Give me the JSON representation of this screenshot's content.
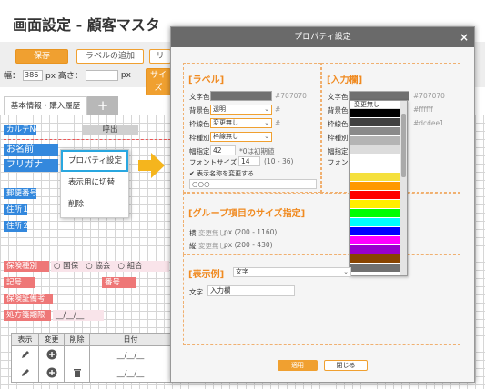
{
  "page": {
    "title": "画面設定 - 顧客マスタ"
  },
  "toolbar": {
    "save_label": "保存",
    "add_label_label": "ラベルの追加",
    "more_label": "リ",
    "size_button_label": "サイズ",
    "width_label": "幅：",
    "width_value": "386",
    "height_label": "px 高さ：",
    "height_unit": "px"
  },
  "tabs": {
    "active_label": "基本情報・購入履歴",
    "add_label": "+"
  },
  "form": {
    "karte_label": "カルテNo",
    "call_label": "呼出",
    "name_label": "お名前",
    "furigana_label": "フリガナ",
    "zip_label": "郵便番号",
    "address1_label": "住所１",
    "address2_label": "住所２",
    "insurance_type_label": "保険種別",
    "insurance_options": [
      "○ 国保",
      "○ 協会",
      "○ 組合"
    ],
    "symbol_label": "記号",
    "number_label": "番号",
    "cert_label": "保険証備考",
    "expiry_label": "処方箋期限",
    "date_placeholder": "__/__/__"
  },
  "context_menu": {
    "items": [
      "プロパティ設定",
      "表示用に切替",
      "削除"
    ]
  },
  "table": {
    "headers": [
      "表示",
      "変更",
      "削除",
      "日付"
    ],
    "date_placeholder": "__/__/__"
  },
  "dialog": {
    "title": "プロパティ設定",
    "close_glyph": "×",
    "label_section": {
      "title": "[ラベル]",
      "text_color_label": "文字色",
      "text_color_value": "#707070",
      "text_color_hex": "#707070",
      "bg_color_label": "背景色",
      "bg_color_value": "透明",
      "bg_hash": "#",
      "border_color_label": "枠線色",
      "border_color_value": "変更無し",
      "border_hash": "#",
      "border_type_label": "枠種別",
      "border_type_value": "枠線無し",
      "width_label": "幅指定",
      "width_value": "42",
      "width_hint": "*0は初期値",
      "font_size_label": "フォントサイズ",
      "font_size_value": "14",
      "font_size_range": "(10 - 36)",
      "display_name_check": "✔ 表示名称を変更する",
      "display_name_value": "○○○"
    },
    "input_section": {
      "title": "[入力欄]",
      "text_color_label": "文字色",
      "text_color_hex": "#707070",
      "bg_color_label": "背景色",
      "bg_hex": "#ffffff",
      "border_color_label": "枠線色",
      "border_hex": "#dcdee1",
      "border_type_label": "枠種別",
      "width_label": "幅指定",
      "font_label": "フォント"
    },
    "palette": {
      "first_label": "変更無し",
      "colors": [
        "#000000",
        "#404040",
        "#8a8a8a",
        "#b4b4b4",
        "#dcdcdc",
        "#ffffff",
        "#ffffff",
        "#f5e03c",
        "#ff9900",
        "#ff0000",
        "#ffee00",
        "#00ff00",
        "#00ffff",
        "#0000ff",
        "#ff00ff",
        "#9900cc",
        "#884400",
        "#707070"
      ]
    },
    "group_section": {
      "title": "[グループ項目のサイズ指定]",
      "width_label": "横",
      "width_value": "変更無し",
      "width_range": "px (200 - 1160)",
      "height_label": "縦",
      "height_value": "変更無し",
      "height_range": "px (200 - 430)"
    },
    "example_section": {
      "title": "[表示例]",
      "select_value": "文字",
      "text_label": "文字",
      "input_value": "入力欄"
    },
    "apply_label": "適用",
    "close_label": "閉じる"
  },
  "colors": {
    "accent": "#f0a030",
    "blue_field": "#3388dd",
    "pink_field": "#ee7777",
    "header": "#6a6a6a"
  }
}
